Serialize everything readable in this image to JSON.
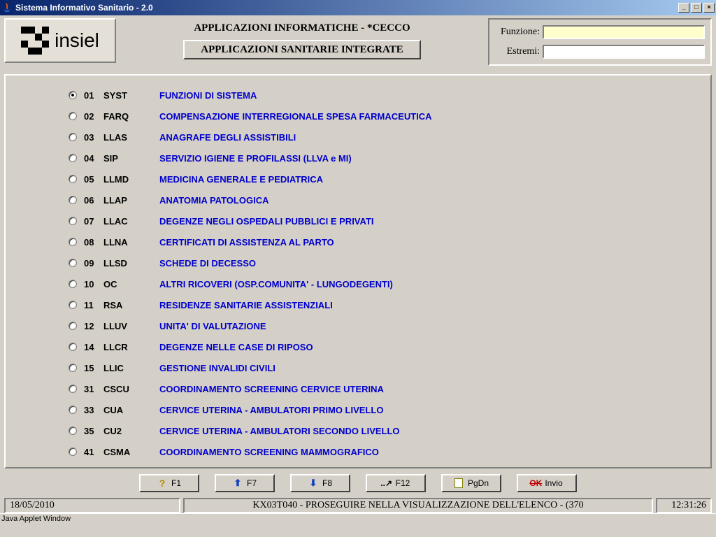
{
  "window": {
    "title": "Sistema Informativo Sanitario - 2.0",
    "min": "_",
    "max": "□",
    "close": "×"
  },
  "header": {
    "logo_text": "insiel",
    "subtitle": "APPLICAZIONI INFORMATICHE  -  *CECCO",
    "big_button": "APPLICAZIONI SANITARIE INTEGRATE",
    "field1_label": "Funzione:",
    "field1_value": "",
    "field2_label": "Estremi:",
    "field2_value": ""
  },
  "menu": [
    {
      "num": "01",
      "code": "SYST",
      "desc": "FUNZIONI DI SISTEMA",
      "selected": true
    },
    {
      "num": "02",
      "code": "FARQ",
      "desc": "COMPENSAZIONE INTERREGIONALE SPESA FARMACEUTICA",
      "selected": false
    },
    {
      "num": "03",
      "code": "LLAS",
      "desc": "ANAGRAFE DEGLI ASSISTIBILI",
      "selected": false
    },
    {
      "num": "04",
      "code": "SIP",
      "desc": "SERVIZIO IGIENE E PROFILASSI (LLVA e MI)",
      "selected": false
    },
    {
      "num": "05",
      "code": "LLMD",
      "desc": "MEDICINA GENERALE E PEDIATRICA",
      "selected": false
    },
    {
      "num": "06",
      "code": "LLAP",
      "desc": "ANATOMIA PATOLOGICA",
      "selected": false
    },
    {
      "num": "07",
      "code": "LLAC",
      "desc": "DEGENZE NEGLI OSPEDALI PUBBLICI E PRIVATI",
      "selected": false
    },
    {
      "num": "08",
      "code": "LLNA",
      "desc": "CERTIFICATI DI ASSISTENZA AL PARTO",
      "selected": false
    },
    {
      "num": "09",
      "code": "LLSD",
      "desc": "SCHEDE DI DECESSO",
      "selected": false
    },
    {
      "num": "10",
      "code": "OC",
      "desc": "ALTRI RICOVERI (OSP.COMUNITA' - LUNGODEGENTI)",
      "selected": false
    },
    {
      "num": "11",
      "code": "RSA",
      "desc": "RESIDENZE SANITARIE ASSISTENZIALI",
      "selected": false
    },
    {
      "num": "12",
      "code": "LLUV",
      "desc": "UNITA' DI VALUTAZIONE",
      "selected": false
    },
    {
      "num": "14",
      "code": "LLCR",
      "desc": "DEGENZE NELLE CASE DI RIPOSO",
      "selected": false
    },
    {
      "num": "15",
      "code": "LLIC",
      "desc": "GESTIONE INVALIDI CIVILI",
      "selected": false
    },
    {
      "num": "31",
      "code": "CSCU",
      "desc": "COORDINAMENTO SCREENING CERVICE UTERINA",
      "selected": false
    },
    {
      "num": "33",
      "code": "CUA",
      "desc": "CERVICE UTERINA - AMBULATORI  PRIMO  LIVELLO",
      "selected": false
    },
    {
      "num": "35",
      "code": "CU2",
      "desc": "CERVICE UTERINA - AMBULATORI SECONDO LIVELLO",
      "selected": false
    },
    {
      "num": "41",
      "code": "CSMA",
      "desc": "COORDINAMENTO SCREENING MAMMOGRAFICO",
      "selected": false
    }
  ],
  "buttons": {
    "f1": "F1",
    "f7": "F7",
    "f8": "F8",
    "f12": "F12",
    "pgdn": "PgDn",
    "invio": "Invio",
    "ok": "OK"
  },
  "status": {
    "date": "18/05/2010",
    "message": "KX03T040 - PROSEGUIRE NELLA VISUALIZZAZIONE DELL'ELENCO  -  (370",
    "time": "12:31:26"
  },
  "footer": "Java Applet Window"
}
